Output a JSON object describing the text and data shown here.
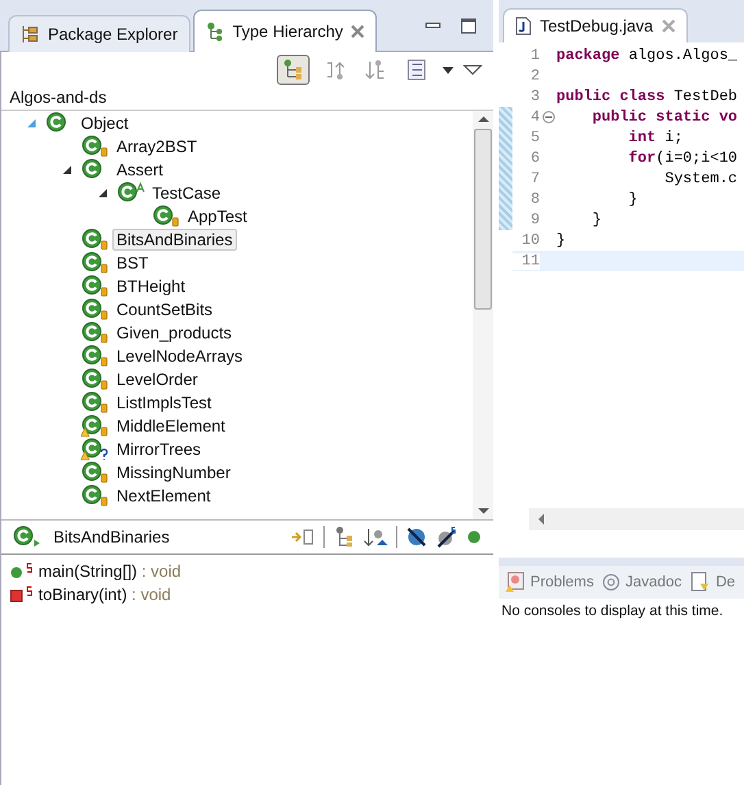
{
  "left_tabs": [
    {
      "label": "Package Explorer",
      "selected": false,
      "closable": false
    },
    {
      "label": "Type Hierarchy",
      "selected": true,
      "closable": true
    }
  ],
  "hierarchy_toolbar": [
    {
      "kind": "type-hierarchy",
      "selected": true
    },
    {
      "kind": "supertype",
      "selected": false
    },
    {
      "kind": "subtype",
      "selected": false
    },
    {
      "kind": "layout",
      "selected": false
    }
  ],
  "project": "Algos-and-ds",
  "tree": [
    {
      "name": "Object",
      "kind": "plain",
      "warning": false,
      "selected": false,
      "expanded": true,
      "children": [
        {
          "name": "Array2BST",
          "kind": "locked",
          "warning": false,
          "selected": false
        },
        {
          "name": "Assert",
          "kind": "plain",
          "warning": false,
          "selected": false,
          "expanded": true,
          "children": [
            {
              "name": "TestCase",
              "kind": "abstract",
              "warning": false,
              "selected": false,
              "expanded": true,
              "children": [
                {
                  "name": "AppTest",
                  "kind": "locked",
                  "warning": false,
                  "selected": false
                }
              ]
            }
          ]
        },
        {
          "name": "BitsAndBinaries",
          "kind": "locked",
          "warning": false,
          "selected": true
        },
        {
          "name": "BST",
          "kind": "locked",
          "warning": false,
          "selected": false
        },
        {
          "name": "BTHeight",
          "kind": "locked",
          "warning": false,
          "selected": false
        },
        {
          "name": "CountSetBits",
          "kind": "locked",
          "warning": false,
          "selected": false
        },
        {
          "name": "Given_products",
          "kind": "locked",
          "warning": false,
          "selected": false
        },
        {
          "name": "LevelNodeArrays",
          "kind": "locked",
          "warning": false,
          "selected": false
        },
        {
          "name": "LevelOrder",
          "kind": "locked",
          "warning": false,
          "selected": false
        },
        {
          "name": "ListImplsTest",
          "kind": "locked",
          "warning": false,
          "selected": false
        },
        {
          "name": "MiddleElement",
          "kind": "locked",
          "warning": true,
          "selected": false
        },
        {
          "name": "MirrorTrees",
          "kind": "unknown",
          "warning": true,
          "selected": false
        },
        {
          "name": "MissingNumber",
          "kind": "locked",
          "warning": false,
          "selected": false
        },
        {
          "name": "NextElement",
          "kind": "locked",
          "warning": false,
          "selected": false
        }
      ]
    }
  ],
  "member_view": {
    "type_name": "BitsAndBinaries",
    "members": [
      {
        "name": "main(String[])",
        "return_type": ": void",
        "kind": "public",
        "static": true
      },
      {
        "name": "toBinary(int)",
        "return_type": ": void",
        "kind": "private",
        "static": true
      }
    ]
  },
  "editor": {
    "tab": "TestDebug.java",
    "lines": [
      {
        "number": "1",
        "fold": false,
        "current": false,
        "changed": false,
        "tokens": [
          {
            "text": "package",
            "kind": "keyword"
          },
          {
            "text": " algos.Algos_",
            "kind": "plain"
          }
        ]
      },
      {
        "number": "2",
        "fold": false,
        "current": false,
        "changed": false
      },
      {
        "number": "3",
        "fold": false,
        "current": false,
        "changed": false,
        "tokens": [
          {
            "text": "public class",
            "kind": "keyword"
          },
          {
            "text": " TestDeb",
            "kind": "plain"
          }
        ]
      },
      {
        "number": "4",
        "fold": true,
        "current": false,
        "changed": true,
        "tokens": [
          {
            "text": "    public static",
            "kind": "keyword"
          },
          {
            "text": " vo",
            "kind": "keyword"
          }
        ]
      },
      {
        "number": "5",
        "fold": false,
        "current": false,
        "changed": true,
        "tokens": [
          {
            "text": "        int",
            "kind": "keyword"
          },
          {
            "text": " i;",
            "kind": "plain"
          }
        ]
      },
      {
        "number": "6",
        "fold": false,
        "current": false,
        "changed": true,
        "tokens": [
          {
            "text": "        for",
            "kind": "keyword"
          },
          {
            "text": "(i=0;i<10",
            "kind": "plain"
          }
        ]
      },
      {
        "number": "7",
        "fold": false,
        "current": false,
        "changed": true,
        "tokens": [
          {
            "text": "            System.c",
            "kind": "plain"
          }
        ]
      },
      {
        "number": "8",
        "fold": false,
        "current": false,
        "changed": true,
        "tokens": [
          {
            "text": "        }",
            "kind": "plain"
          }
        ]
      },
      {
        "number": "9",
        "fold": false,
        "current": false,
        "changed": true,
        "tokens": [
          {
            "text": "    }",
            "kind": "plain"
          }
        ]
      },
      {
        "number": "10",
        "fold": false,
        "current": false,
        "changed": false,
        "tokens": [
          {
            "text": "}",
            "kind": "plain"
          }
        ]
      },
      {
        "number": "11",
        "fold": false,
        "current": true,
        "changed": false
      }
    ]
  },
  "bottom_tabs": [
    {
      "label": "Problems",
      "kind": "problems"
    },
    {
      "label": "Javadoc",
      "kind": "javadoc"
    },
    {
      "label": "De",
      "kind": "declaration"
    }
  ],
  "console_message": "No consoles to display at this time."
}
